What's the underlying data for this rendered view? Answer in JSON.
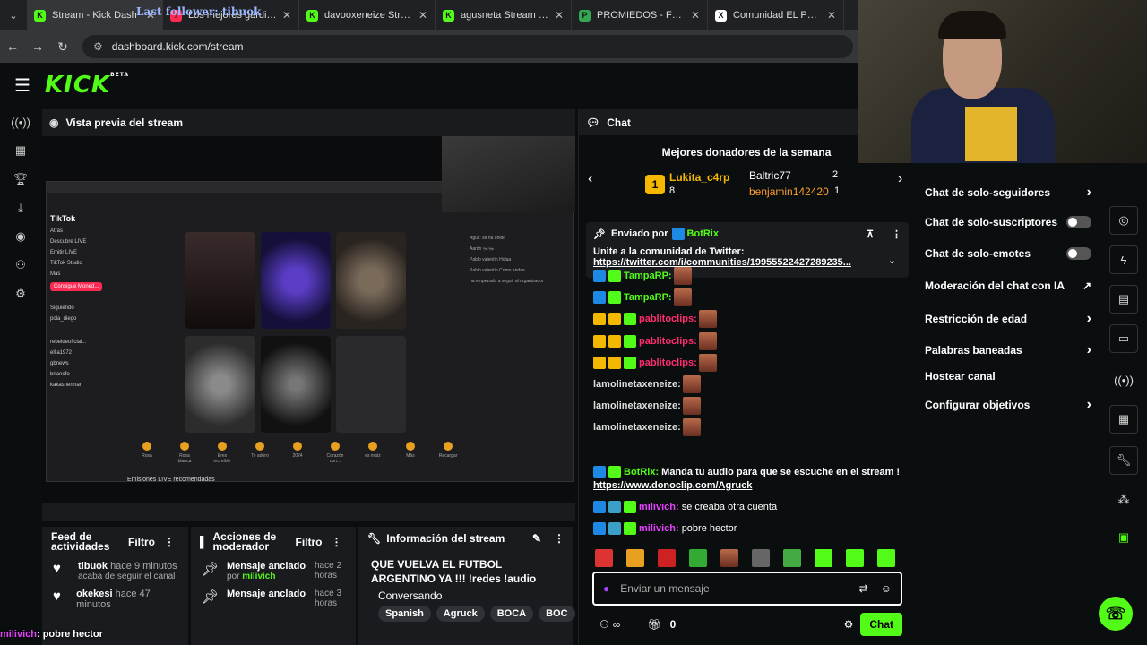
{
  "browser": {
    "tabs": [
      {
        "title": "Stream - Kick Dash",
        "color": "#53fc18",
        "letter": "K"
      },
      {
        "title": "Los mejores gardien",
        "color": "#fe2c55",
        "letter": "♪"
      },
      {
        "title": "davooxeneize Stream",
        "color": "#53fc18",
        "letter": "K"
      },
      {
        "title": "agusneta Stream - Wa",
        "color": "#53fc18",
        "letter": "K"
      },
      {
        "title": "PROMIEDOS - Futbol",
        "color": "#34a853",
        "letter": "P"
      },
      {
        "title": "Comunidad EL PLANE",
        "color": "#ffffff",
        "letter": "X"
      }
    ],
    "url": "dashboard.kick.com/stream",
    "overlay_text": "Last follower: tibuok"
  },
  "kick": {
    "logo": "KICK",
    "beta": "BETA"
  },
  "preview": {
    "title": "Vista previa del stream",
    "mini": {
      "tiktok": "TikTok",
      "side": [
        "Atrás",
        "Descubre LIVE",
        "Emitir LIVE",
        "TikTok Studio",
        "Más"
      ],
      "button": "Consigue Moned...",
      "following": "Siguiendo",
      "creators": [
        "pola_diego",
        "rebeldeoficial...",
        "ellia1972",
        "gbnews",
        "brianofo",
        "kakasherman"
      ],
      "names": [
        "Francisco González",
        "Esteban Aranda",
        "Aarón"
      ],
      "chat": [
        "Agus: se ha unido",
        "Aarón 🐜🐜",
        "Pablo valentín Holaa",
        "Pablo valentín Como andan",
        "ha empezado a seguir al organizador"
      ],
      "gifts": [
        "Rosa",
        "Rosa blanca",
        "Eres increíble",
        "Te adoro",
        "2024",
        "Corazón con...",
        "es maíz",
        "Más",
        "Recargar"
      ],
      "bottom": "Emisiones LIVE recomendadas"
    }
  },
  "feed": {
    "title": "Feed de actividades",
    "filter": "Filtro",
    "items": [
      {
        "user": "tibuok",
        "time": "hace 9 minutos",
        "text": "acaba de seguir el canal"
      },
      {
        "user": "okekesi",
        "time": "hace 47 minutos",
        "text": ""
      }
    ]
  },
  "mod": {
    "title": "Acciones de moderador",
    "filter": "Filtro",
    "items": [
      {
        "label": "Mensaje anclado",
        "time": "hace 2 horas",
        "by_prefix": "por",
        "by": "milivich"
      },
      {
        "label": "Mensaje anclado",
        "time": "hace 3 horas"
      }
    ]
  },
  "info": {
    "title": "Información del stream",
    "stream_title": "QUE VUELVA EL FUTBOL ARGENTINO YA !!! !redes !audio",
    "category": "Conversando",
    "tags": [
      "Spanish",
      "Agruck",
      "BOCA",
      "BOC"
    ]
  },
  "chat": {
    "title": "Chat",
    "donors_title": "Mejores donadores de la semana",
    "top_donor": {
      "name": "Lukita_c4rp",
      "rank": "1",
      "count": "8"
    },
    "donors": [
      {
        "name": "Baltric77",
        "count": "2"
      },
      {
        "name": "benjamin142420",
        "count": "1"
      }
    ],
    "pinned": {
      "by_label": "Enviado por",
      "by": "BotRix",
      "text": "Unite a la comunidad de Twitter:",
      "link": "https://twitter.com/i/communities/19955522427289235..."
    },
    "messages": [
      {
        "user": "TampaRP:",
        "color": "#53fc18",
        "badges": [
          "bk",
          "bg"
        ]
      },
      {
        "user": "TampaRP:",
        "color": "#53fc18",
        "badges": [
          "bk",
          "bg"
        ]
      },
      {
        "user": "pablitoclips:",
        "color": "#ff2d6f",
        "badges": [
          "by",
          "by",
          "bg"
        ]
      },
      {
        "user": "pablitoclips:",
        "color": "#ff2d6f",
        "badges": [
          "by",
          "by",
          "bg"
        ]
      },
      {
        "user": "pablitoclips:",
        "color": "#ff2d6f",
        "badges": [
          "by",
          "by",
          "bg"
        ]
      },
      {
        "user": "lamolinetaxeneize:",
        "color": "#dddddd",
        "badges": []
      },
      {
        "user": "lamolinetaxeneize:",
        "color": "#dddddd",
        "badges": []
      },
      {
        "user": "lamolinetaxeneize:",
        "color": "#dddddd",
        "badges": []
      }
    ],
    "bot_msg": {
      "user": "BotRix:",
      "text": "Manda tu audio para que se escuche en el stream !",
      "link": "https://www.donoclip.com/Agruck"
    },
    "msg2": {
      "user": "milivich:",
      "text": "se creaba otra cuenta"
    },
    "msg3": {
      "user": "milivich:",
      "text": "pobre hector"
    },
    "input_placeholder": "Enviar un mensaje",
    "count": "0",
    "send": "Chat"
  },
  "settings": {
    "items": [
      {
        "label": "Chat de solo-seguidores",
        "control": "chevron"
      },
      {
        "label": "Chat de solo-suscriptores",
        "control": "toggle"
      },
      {
        "label": "Chat de solo-emotes",
        "control": "toggle"
      },
      {
        "label": "Moderación del chat con IA",
        "control": "ext"
      },
      {
        "label": "Restricción de edad",
        "control": "chevron"
      },
      {
        "label": "Palabras baneadas",
        "control": "chevron"
      },
      {
        "label": "Hostear canal",
        "control": "none"
      },
      {
        "label": "Configurar objetivos",
        "control": "chevron"
      }
    ]
  },
  "overlay": {
    "user": "milivich",
    "text": ": pobre hector"
  }
}
